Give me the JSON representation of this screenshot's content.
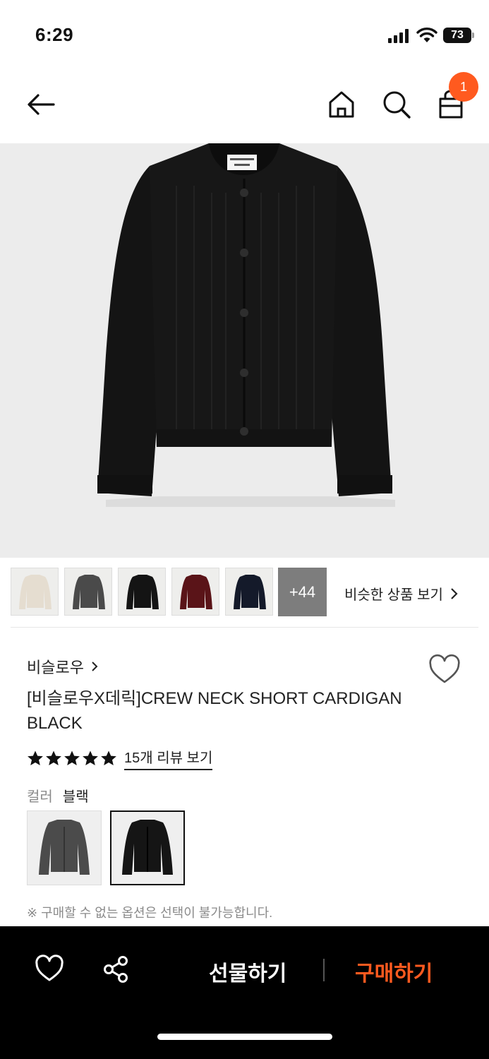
{
  "status_bar": {
    "time": "6:29",
    "battery": "73"
  },
  "header": {
    "cart_count": "1"
  },
  "thumbnails": [
    {
      "color": "#e5ddd0"
    },
    {
      "color": "#4a4a4a"
    },
    {
      "color": "#141414"
    },
    {
      "color": "#5a1418"
    },
    {
      "color": "#141a2a"
    }
  ],
  "more_count": "+44",
  "similar_link": "비슷한 상품 보기",
  "brand": "비슬로우",
  "product_name": "[비슬로우X데릭]CREW NECK SHORT CARDIGAN BLACK",
  "rating": {
    "stars": 5,
    "review_text": "15개 리뷰 보기"
  },
  "color_option": {
    "label": "컬러",
    "value": "블랙"
  },
  "notice": "※ 구매할 수 없는 옵션은 선택이 불가능합니다.",
  "bottom_bar": {
    "gift_label": "선물하기",
    "buy_label": "구매하기"
  },
  "colors": {
    "accent": "#ff5a1f",
    "bottom_bar_bg": "#000000"
  },
  "icons": [
    "back-arrow-icon",
    "home-icon",
    "search-icon",
    "shopping-bag-icon",
    "heart-icon",
    "share-icon",
    "star-icon",
    "chevron-right-icon"
  ]
}
